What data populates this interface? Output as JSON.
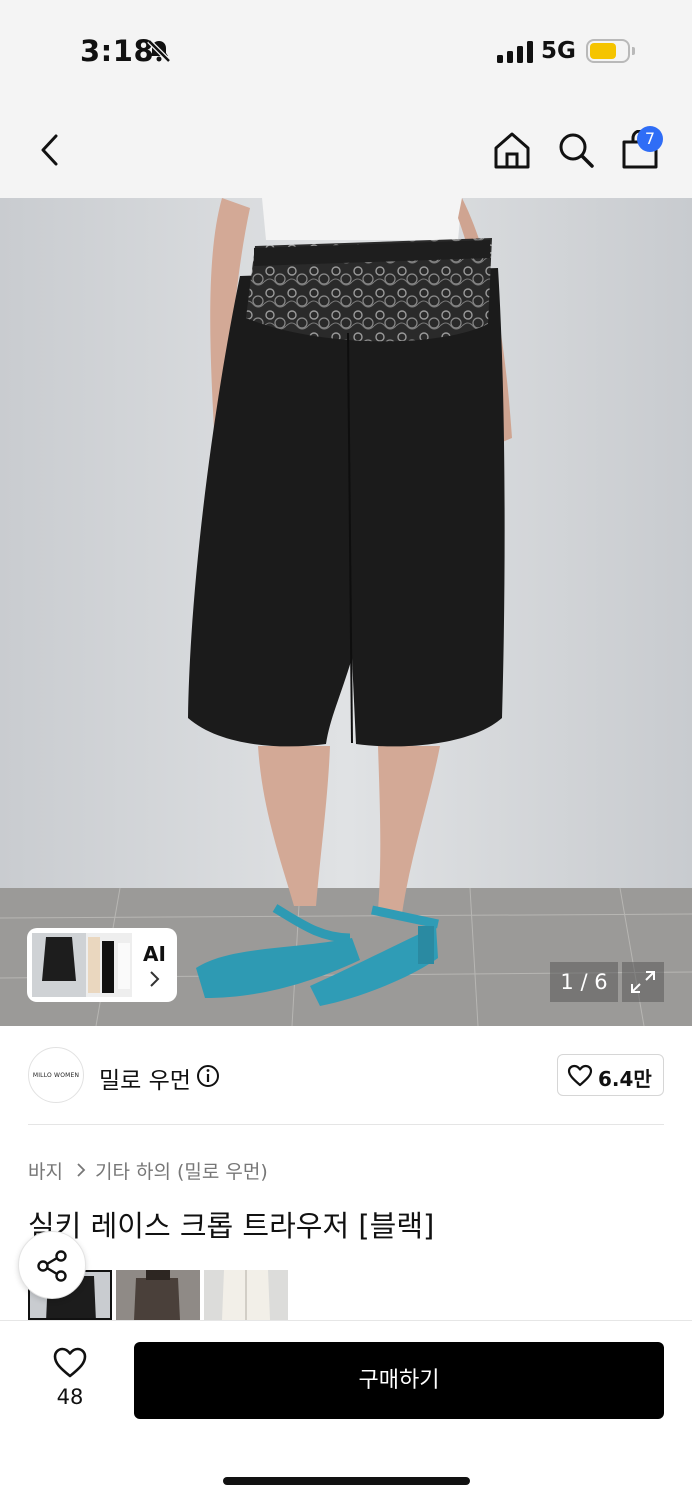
{
  "status_bar": {
    "time": "3:18",
    "network": "5G",
    "icons": [
      "bell-slash-icon",
      "signal-icon",
      "battery-icon"
    ],
    "battery_color": "#f5c400"
  },
  "nav": {
    "icons": [
      "back-chevron-icon",
      "home-icon",
      "search-icon",
      "shopping-bag-icon"
    ],
    "cart_count": "7",
    "badge_color": "#2f6df6"
  },
  "gallery": {
    "ai_label": "AI",
    "page_indicator": "1 / 6",
    "expand_icon": "expand-icon"
  },
  "brand": {
    "logo_text": "MILLO WOMEN",
    "name": "밀로 우먼",
    "info_icon": "info-icon",
    "like_count": "6.4만"
  },
  "product": {
    "breadcrumb": [
      "바지",
      "기타 하의 (밀로 우먼)"
    ],
    "title": "실키 레이스 크롭 트라우저 [블랙]"
  },
  "bottom_bar": {
    "wish_count": "48",
    "buy_label": "구매하기"
  }
}
